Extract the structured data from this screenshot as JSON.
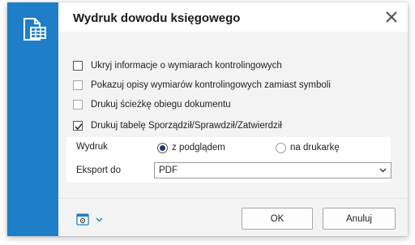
{
  "dialog": {
    "title": "Wydruk dowodu księgowego",
    "icon": "document-table-icon",
    "accent_color": "#1e7ec8"
  },
  "options": [
    {
      "label": "Ukryj informacje o wymiarach kontrolingowych",
      "checked": false,
      "enabled": true
    },
    {
      "label": "Pokazuj opisy wymiarów kontrolingowych zamiast symboli",
      "checked": false,
      "enabled": false
    },
    {
      "label": "Drukuj ścieżkę obiegu dokumentu",
      "checked": false,
      "enabled": false
    },
    {
      "label": "Drukuj tabelę Sporządził/Sprawdził/Zatwierdził",
      "checked": true,
      "enabled": true
    }
  ],
  "print_section": {
    "wydruk_label": "Wydruk",
    "radio_preview": "z podglądem",
    "radio_printer": "na drukarkę",
    "selected": "z podglądem",
    "export_label": "Eksport do",
    "export_value": "PDF"
  },
  "footer": {
    "ok_label": "OK",
    "cancel_label": "Anuluj",
    "settings_icon": "settings-gear-icon"
  }
}
